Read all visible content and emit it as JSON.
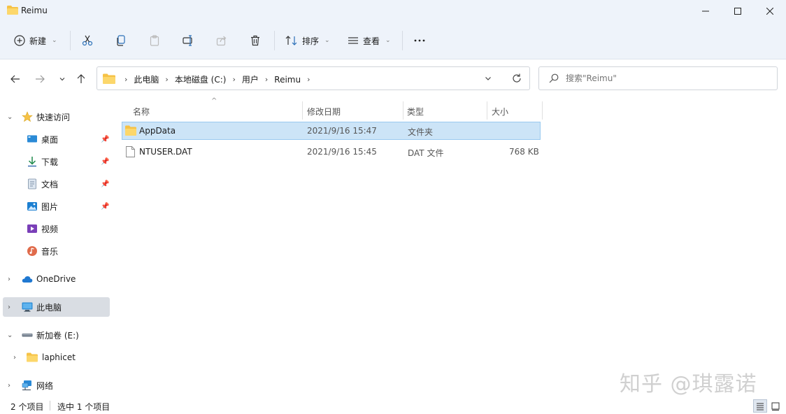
{
  "window": {
    "title": "Reimu"
  },
  "toolbar": {
    "new_label": "新建",
    "sort_label": "排序",
    "view_label": "查看"
  },
  "address": {
    "crumbs": [
      "此电脑",
      "本地磁盘 (C:)",
      "用户",
      "Reimu"
    ]
  },
  "search": {
    "placeholder": "搜索\"Reimu\""
  },
  "sidebar": {
    "quick_access": "快速访问",
    "items": [
      "桌面",
      "下载",
      "文档",
      "图片",
      "视频",
      "音乐"
    ],
    "onedrive": "OneDrive",
    "this_pc": "此电脑",
    "new_volume": "新加卷 (E:)",
    "laphicet": "laphicet",
    "network": "网络"
  },
  "columns": {
    "name": "名称",
    "date": "修改日期",
    "type": "类型",
    "size": "大小"
  },
  "files": [
    {
      "name": "AppData",
      "date": "2021/9/16 15:47",
      "type": "文件夹",
      "size": ""
    },
    {
      "name": "NTUSER.DAT",
      "date": "2021/9/16 15:45",
      "type": "DAT 文件",
      "size": "768 KB"
    }
  ],
  "status": {
    "count": "2 个项目",
    "selected": "选中 1 个项目"
  },
  "watermark": "知乎 @琪露诺",
  "colors": {
    "accent": "#0067c0",
    "folder": "#f6c246",
    "selection": "#cce4f7"
  }
}
